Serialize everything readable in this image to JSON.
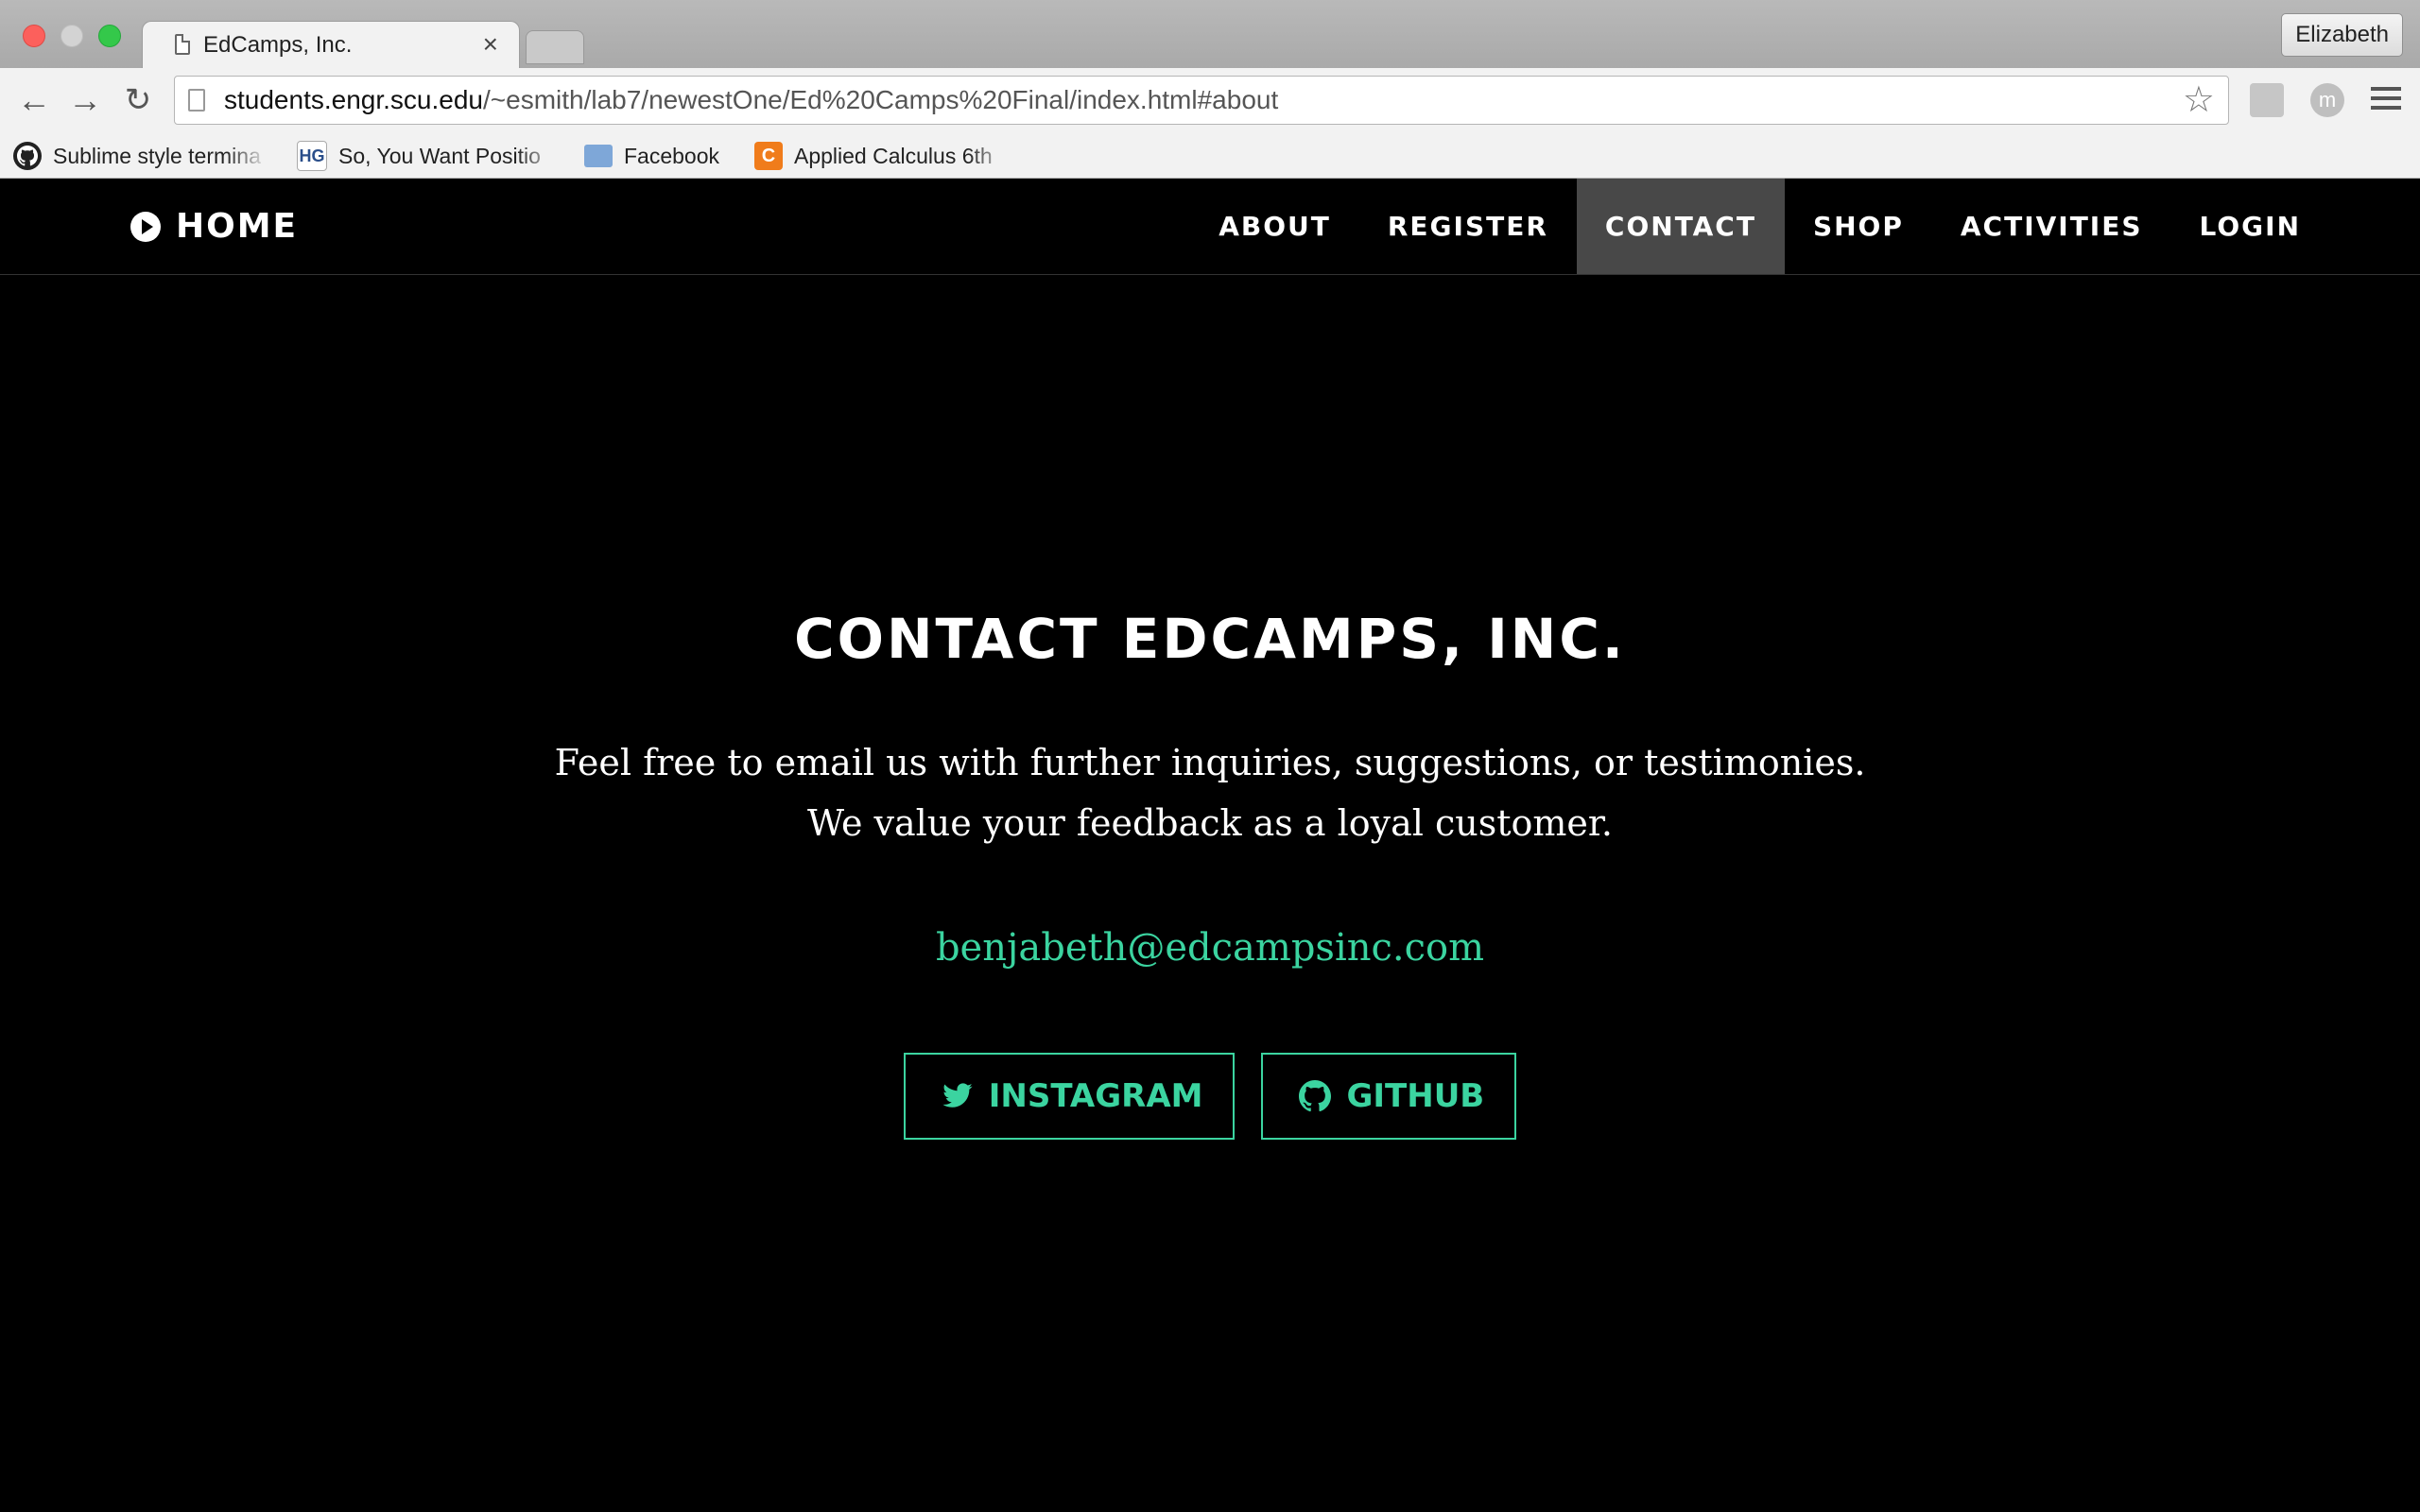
{
  "browser": {
    "tab_title": "EdCamps, Inc.",
    "tab_close": "×",
    "profile": "Elizabeth",
    "url_host": "students.engr.scu.edu",
    "url_path": "/~esmith/lab7/newestOne/Ed%20Camps%20Final/index.html#about",
    "ext_letter": "m",
    "bookmarks": [
      {
        "label": "Sublime style termina",
        "icon": "github-icon"
      },
      {
        "label": "So, You Want Positio",
        "icon_text": "HG"
      },
      {
        "label": "Facebook",
        "icon": "folder-icon"
      },
      {
        "label": "Applied Calculus 6th",
        "icon_text": "C"
      }
    ]
  },
  "nav": {
    "home": "HOME",
    "links": [
      "ABOUT",
      "REGISTER",
      "CONTACT",
      "SHOP",
      "ACTIVITIES",
      "LOGIN"
    ],
    "active": "CONTACT"
  },
  "contact": {
    "heading": "CONTACT EDCAMPS, INC.",
    "lead": "Feel free to email us with further inquiries, suggestions, or testimonies. We value your feedback as a loyal customer.",
    "email": "benjabeth@edcampsinc.com",
    "buttons": [
      {
        "label": "INSTAGRAM",
        "icon": "twitter-bird-icon"
      },
      {
        "label": "GITHUB",
        "icon": "github-icon"
      }
    ]
  },
  "colors": {
    "accent": "#3bd4a0",
    "background": "#000000",
    "nav_active": "#484848"
  }
}
